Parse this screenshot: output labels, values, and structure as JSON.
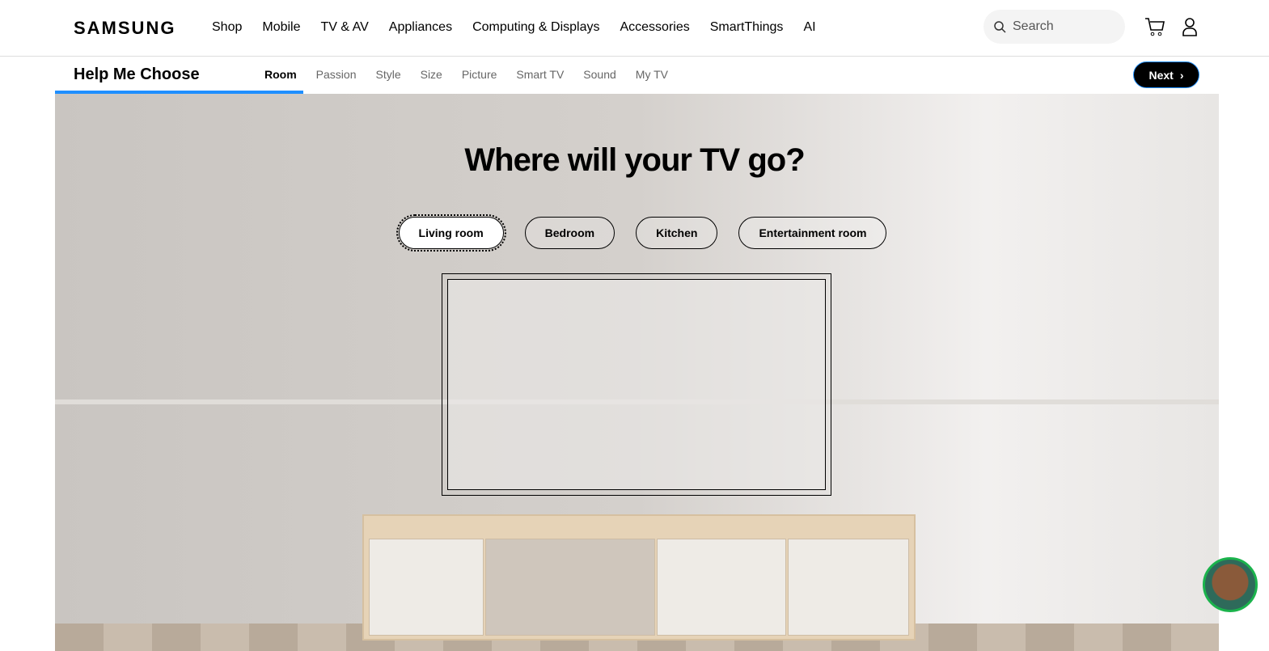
{
  "header": {
    "logo": "SAMSUNG",
    "nav": [
      "Shop",
      "Mobile",
      "TV & AV",
      "Appliances",
      "Computing & Displays",
      "Accessories",
      "SmartThings",
      "AI"
    ],
    "search_placeholder": "Search"
  },
  "subnav": {
    "title": "Help Me Choose",
    "steps": [
      "Room",
      "Passion",
      "Style",
      "Size",
      "Picture",
      "Smart TV",
      "Sound",
      "My TV"
    ],
    "next": "Next",
    "accent": "#1f8fff"
  },
  "hero": {
    "question": "Where will your TV go?",
    "options": [
      "Living room",
      "Bedroom",
      "Kitchen",
      "Entertainment room"
    ],
    "selected": "Living room"
  }
}
